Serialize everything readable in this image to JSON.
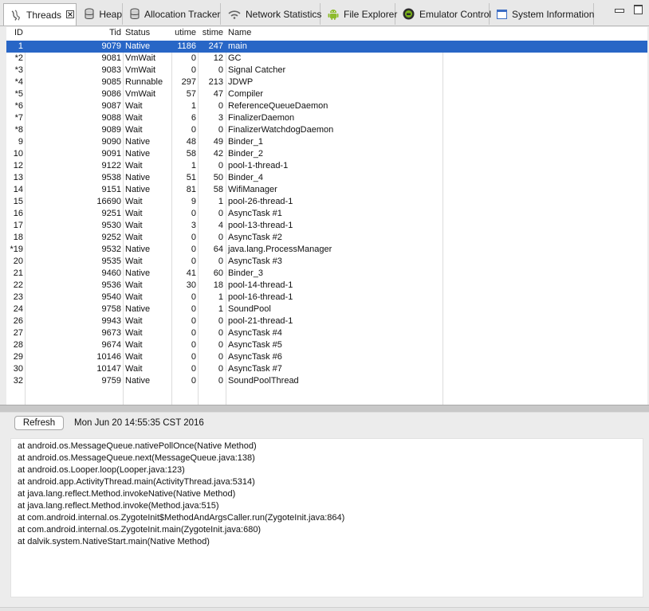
{
  "tabs": [
    {
      "label": "Threads",
      "icon": "threads-icon",
      "active": true
    },
    {
      "label": "Heap",
      "icon": "heap-icon",
      "active": false
    },
    {
      "label": "Allocation Tracker",
      "icon": "allocation-tracker-icon",
      "active": false
    },
    {
      "label": "Network Statistics",
      "icon": "network-statistics-icon",
      "active": false
    },
    {
      "label": "File Explorer",
      "icon": "android-icon",
      "active": false
    },
    {
      "label": "Emulator Control",
      "icon": "emulator-control-icon",
      "active": false
    },
    {
      "label": "System Information",
      "icon": "system-information-icon",
      "active": false
    }
  ],
  "table": {
    "headers": {
      "id": "ID",
      "tid": "Tid",
      "status": "Status",
      "utime": "utime",
      "stime": "stime",
      "name": "Name"
    },
    "selected_row": 0,
    "rows": [
      {
        "id": "1",
        "tid": "9079",
        "status": "Native",
        "utime": "1186",
        "stime": "247",
        "name": "main"
      },
      {
        "id": "*2",
        "tid": "9081",
        "status": "VmWait",
        "utime": "0",
        "stime": "12",
        "name": "GC"
      },
      {
        "id": "*3",
        "tid": "9083",
        "status": "VmWait",
        "utime": "0",
        "stime": "0",
        "name": "Signal Catcher"
      },
      {
        "id": "*4",
        "tid": "9085",
        "status": "Runnable",
        "utime": "297",
        "stime": "213",
        "name": "JDWP"
      },
      {
        "id": "*5",
        "tid": "9086",
        "status": "VmWait",
        "utime": "57",
        "stime": "47",
        "name": "Compiler"
      },
      {
        "id": "*6",
        "tid": "9087",
        "status": "Wait",
        "utime": "1",
        "stime": "0",
        "name": "ReferenceQueueDaemon"
      },
      {
        "id": "*7",
        "tid": "9088",
        "status": "Wait",
        "utime": "6",
        "stime": "3",
        "name": "FinalizerDaemon"
      },
      {
        "id": "*8",
        "tid": "9089",
        "status": "Wait",
        "utime": "0",
        "stime": "0",
        "name": "FinalizerWatchdogDaemon"
      },
      {
        "id": "9",
        "tid": "9090",
        "status": "Native",
        "utime": "48",
        "stime": "49",
        "name": "Binder_1"
      },
      {
        "id": "10",
        "tid": "9091",
        "status": "Native",
        "utime": "58",
        "stime": "42",
        "name": "Binder_2"
      },
      {
        "id": "12",
        "tid": "9122",
        "status": "Wait",
        "utime": "1",
        "stime": "0",
        "name": "pool-1-thread-1"
      },
      {
        "id": "13",
        "tid": "9538",
        "status": "Native",
        "utime": "51",
        "stime": "50",
        "name": "Binder_4"
      },
      {
        "id": "14",
        "tid": "9151",
        "status": "Native",
        "utime": "81",
        "stime": "58",
        "name": "WifiManager"
      },
      {
        "id": "15",
        "tid": "16690",
        "status": "Wait",
        "utime": "9",
        "stime": "1",
        "name": "pool-26-thread-1"
      },
      {
        "id": "16",
        "tid": "9251",
        "status": "Wait",
        "utime": "0",
        "stime": "0",
        "name": "AsyncTask #1"
      },
      {
        "id": "17",
        "tid": "9530",
        "status": "Wait",
        "utime": "3",
        "stime": "4",
        "name": "pool-13-thread-1"
      },
      {
        "id": "18",
        "tid": "9252",
        "status": "Wait",
        "utime": "0",
        "stime": "0",
        "name": "AsyncTask #2"
      },
      {
        "id": "*19",
        "tid": "9532",
        "status": "Native",
        "utime": "0",
        "stime": "64",
        "name": "java.lang.ProcessManager"
      },
      {
        "id": "20",
        "tid": "9535",
        "status": "Wait",
        "utime": "0",
        "stime": "0",
        "name": "AsyncTask #3"
      },
      {
        "id": "21",
        "tid": "9460",
        "status": "Native",
        "utime": "41",
        "stime": "60",
        "name": "Binder_3"
      },
      {
        "id": "22",
        "tid": "9536",
        "status": "Wait",
        "utime": "30",
        "stime": "18",
        "name": "pool-14-thread-1"
      },
      {
        "id": "23",
        "tid": "9540",
        "status": "Wait",
        "utime": "0",
        "stime": "1",
        "name": "pool-16-thread-1"
      },
      {
        "id": "24",
        "tid": "9758",
        "status": "Native",
        "utime": "0",
        "stime": "1",
        "name": "SoundPool"
      },
      {
        "id": "26",
        "tid": "9943",
        "status": "Wait",
        "utime": "0",
        "stime": "0",
        "name": "pool-21-thread-1"
      },
      {
        "id": "27",
        "tid": "9673",
        "status": "Wait",
        "utime": "0",
        "stime": "0",
        "name": "AsyncTask #4"
      },
      {
        "id": "28",
        "tid": "9674",
        "status": "Wait",
        "utime": "0",
        "stime": "0",
        "name": "AsyncTask #5"
      },
      {
        "id": "29",
        "tid": "10146",
        "status": "Wait",
        "utime": "0",
        "stime": "0",
        "name": "AsyncTask #6"
      },
      {
        "id": "30",
        "tid": "10147",
        "status": "Wait",
        "utime": "0",
        "stime": "0",
        "name": "AsyncTask #7"
      },
      {
        "id": "32",
        "tid": "9759",
        "status": "Native",
        "utime": "0",
        "stime": "0",
        "name": "SoundPoolThread"
      }
    ]
  },
  "details": {
    "refresh_label": "Refresh",
    "timestamp": "Mon Jun 20 14:55:35 CST 2016",
    "stack_trace": [
      "at android.os.MessageQueue.nativePollOnce(Native Method)",
      "at android.os.MessageQueue.next(MessageQueue.java:138)",
      "at android.os.Looper.loop(Looper.java:123)",
      "at android.app.ActivityThread.main(ActivityThread.java:5314)",
      "at java.lang.reflect.Method.invokeNative(Native Method)",
      "at java.lang.reflect.Method.invoke(Method.java:515)",
      "at com.android.internal.os.ZygoteInit$MethodAndArgsCaller.run(ZygoteInit.java:864)",
      "at com.android.internal.os.ZygoteInit.main(ZygoteInit.java:680)",
      "at dalvik.system.NativeStart.main(Native Method)"
    ]
  },
  "colors": {
    "selection": "#2866c6",
    "table_bg": "#ffffff",
    "chrome_bg": "#ececec"
  }
}
